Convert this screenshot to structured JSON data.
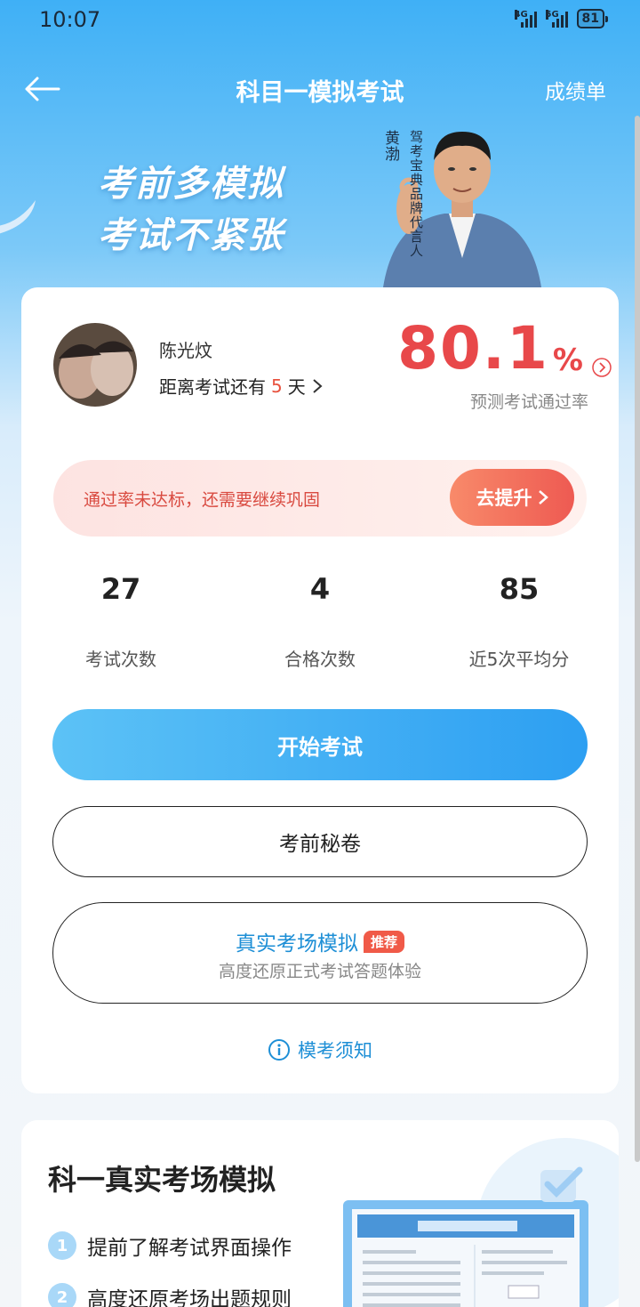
{
  "status_bar": {
    "time": "10:07",
    "net1": "4G",
    "net2": "5G",
    "battery": "81"
  },
  "nav": {
    "title": "科目一模拟考试",
    "right_link": "成绩单"
  },
  "hero": {
    "slogan_line1": "考前多模拟",
    "slogan_line2": "考试不紧张",
    "endorser_name": "黄渤",
    "endorser_title": "驾考宝典品牌代言人"
  },
  "profile": {
    "name": "陈光炆",
    "countdown_prefix": "距离考试还有",
    "countdown_days": "5",
    "countdown_unit": "天",
    "pass_rate_value": "80.1",
    "pass_rate_unit": "%",
    "pass_rate_label": "预测考试通过率"
  },
  "alert": {
    "text": "通过率未达标，还需要继续巩固",
    "button": "去提升"
  },
  "stats": [
    {
      "value": "27",
      "label": "考试次数"
    },
    {
      "value": "4",
      "label": "合格次数"
    },
    {
      "value": "85",
      "label": "近5次平均分"
    }
  ],
  "buttons": {
    "start": "开始考试",
    "secret": "考前秘卷",
    "real_title": "真实考场模拟",
    "real_tag": "推荐",
    "real_sub": "高度还原正式考试答题体验"
  },
  "notice": "模考须知",
  "second_card": {
    "title": "科一真实考场模拟",
    "items": [
      {
        "num": "1",
        "text": "提前了解考试界面操作"
      },
      {
        "num": "2",
        "text": "高度还原考场出题规则"
      }
    ]
  },
  "colors": {
    "primary": "#2d9ff2",
    "accent_red": "#e8484a",
    "link_blue": "#1e8fd6"
  }
}
